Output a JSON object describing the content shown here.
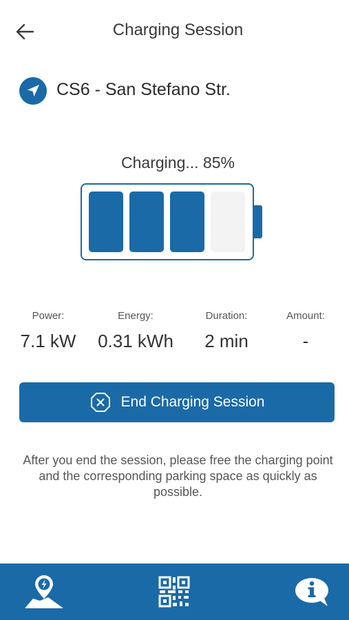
{
  "header": {
    "title": "Charging Session"
  },
  "station": {
    "name": "CS6 - San Stefano Str.",
    "icon": "navigation-arrow-icon"
  },
  "charging": {
    "status_text": "Charging... 85%",
    "level_percent": 85,
    "filled_cells": 3,
    "total_cells": 4
  },
  "stats": [
    {
      "label": "Power:",
      "value": "7.1 kW"
    },
    {
      "label": "Energy:",
      "value": "0.31 kWh"
    },
    {
      "label": "Duration:",
      "value": "2 min"
    },
    {
      "label": "Amount:",
      "value": "-"
    }
  ],
  "end_button": {
    "label": "End Charging Session",
    "icon": "close-circle-icon"
  },
  "info_text": "After you end the session, please free the charging point and the corresponding parking space as quickly as possible.",
  "bottom_nav": [
    {
      "icon": "map-charging-location-icon"
    },
    {
      "icon": "qr-code-icon"
    },
    {
      "icon": "info-chat-icon"
    }
  ],
  "colors": {
    "primary": "#1a6aa8",
    "empty_cell": "#f3f3f3"
  }
}
